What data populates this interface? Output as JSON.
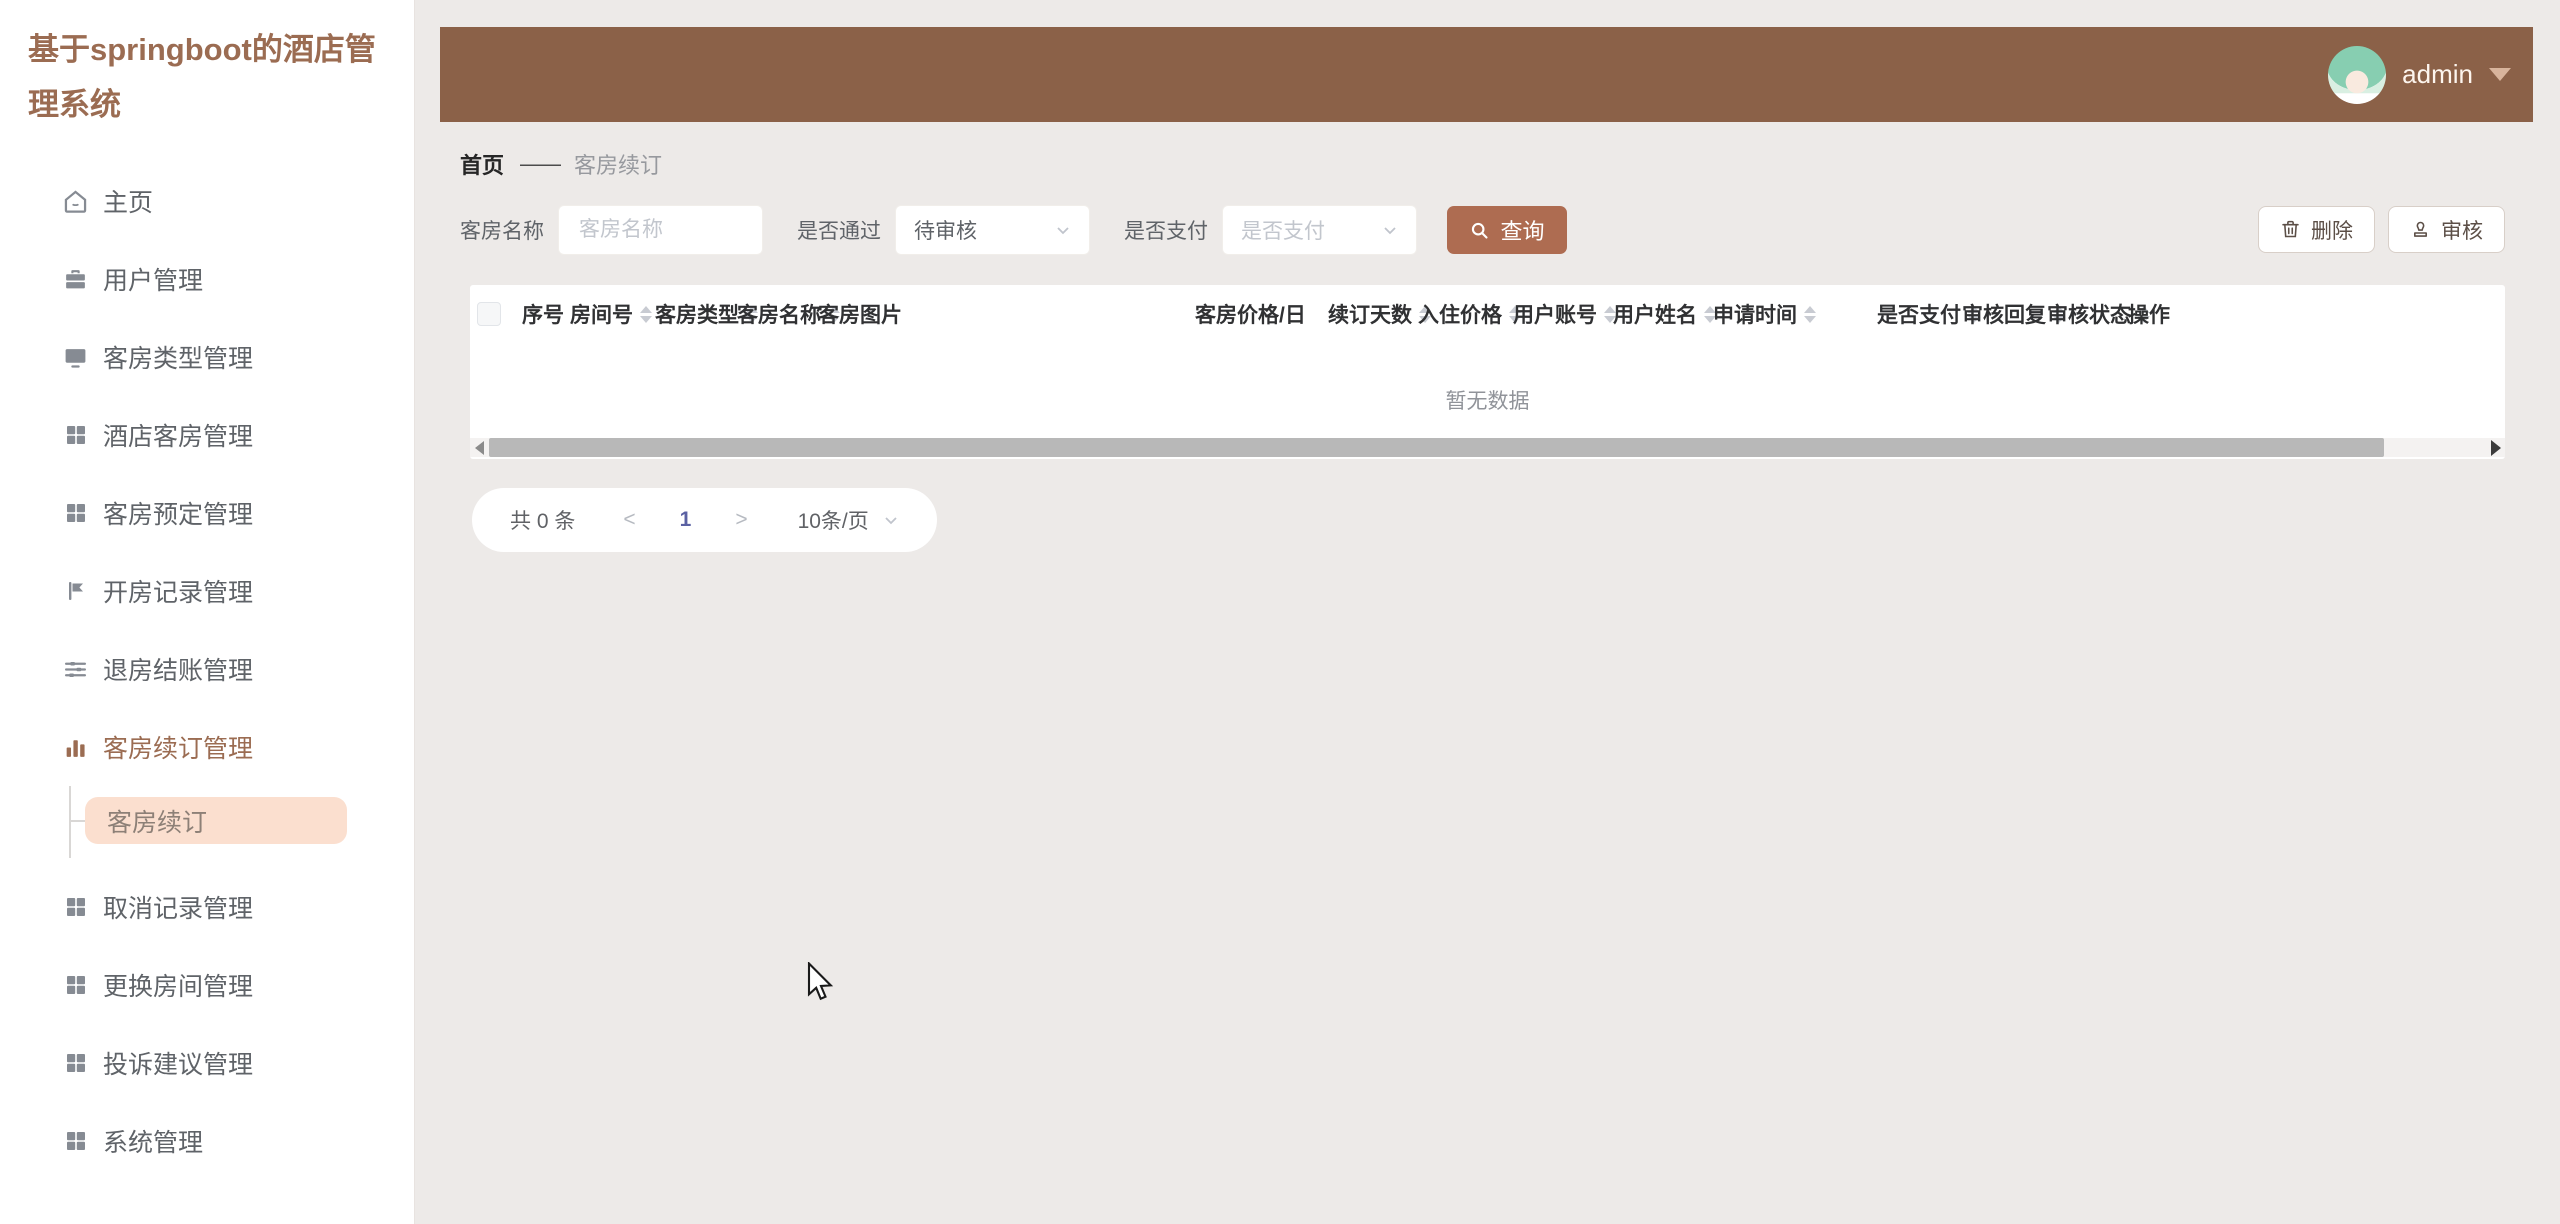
{
  "app": {
    "title": "基于springboot的酒店管理系统"
  },
  "topbar": {
    "username": "admin"
  },
  "sidebar": {
    "items": [
      {
        "label": "主页",
        "icon": "home-icon"
      },
      {
        "label": "用户管理",
        "icon": "briefcase-icon"
      },
      {
        "label": "客房类型管理",
        "icon": "monitor-icon"
      },
      {
        "label": "酒店客房管理",
        "icon": "grid-icon"
      },
      {
        "label": "客房预定管理",
        "icon": "grid-icon"
      },
      {
        "label": "开房记录管理",
        "icon": "flag-icon"
      },
      {
        "label": "退房结账管理",
        "icon": "sliders-icon"
      },
      {
        "label": "客房续订管理",
        "icon": "bar-chart-icon",
        "active": true
      },
      {
        "label": "取消记录管理",
        "icon": "grid-icon"
      },
      {
        "label": "更换房间管理",
        "icon": "grid-icon"
      },
      {
        "label": "投诉建议管理",
        "icon": "grid-icon"
      },
      {
        "label": "系统管理",
        "icon": "grid-icon"
      }
    ],
    "submenu": {
      "label": "客房续订"
    }
  },
  "breadcrumb": {
    "home": "首页",
    "separator": "——",
    "current": "客房续订"
  },
  "filters": {
    "room_name_label": "客房名称",
    "room_name_placeholder": "客房名称",
    "approved_label": "是否通过",
    "approved_value": "待审核",
    "paid_label": "是否支付",
    "paid_placeholder": "是否支付",
    "search_button": "查询"
  },
  "actions": {
    "delete_button": "删除",
    "audit_button": "审核"
  },
  "table": {
    "empty_text": "暂无数据",
    "columns": [
      {
        "label": "序号",
        "sortable": false
      },
      {
        "label": "房间号",
        "sortable": true
      },
      {
        "label": "客房类型",
        "sortable": true
      },
      {
        "label": "客房名称",
        "sortable": true
      },
      {
        "label": "客房图片",
        "sortable": false
      },
      {
        "label": "客房价格/日",
        "sortable": false
      },
      {
        "label": "续订天数",
        "sortable": true
      },
      {
        "label": "入住价格",
        "sortable": true
      },
      {
        "label": "用户账号",
        "sortable": true
      },
      {
        "label": "用户姓名",
        "sortable": true
      },
      {
        "label": "申请时间",
        "sortable": true
      },
      {
        "label": "是否支付",
        "sortable": true
      },
      {
        "label": "审核回复",
        "sortable": true
      },
      {
        "label": "审核状态",
        "sortable": true
      },
      {
        "label": "操作",
        "sortable": false
      }
    ]
  },
  "pagination": {
    "total": "共 0 条",
    "prev": "<",
    "current_page": "1",
    "next": ">",
    "page_size": "10条/页"
  },
  "colors": {
    "header_bg": "#8B6148",
    "accent_button": "#AE6C51",
    "active_menu": "#9B6C52",
    "submenu_bg": "#FBDFCF",
    "page_bg": "#EDEAE8",
    "page_number": "#5B61A3"
  }
}
